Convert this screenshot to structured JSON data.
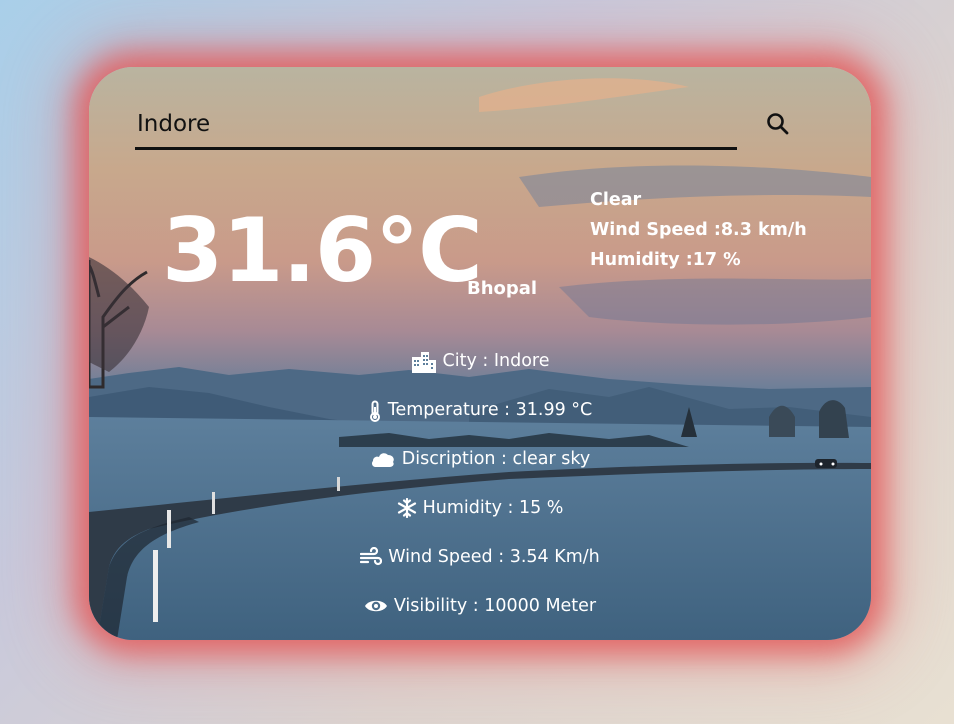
{
  "search": {
    "value": "Indore",
    "icon": "search-icon"
  },
  "current": {
    "temperature": "31.6°C",
    "city": "Bhopal",
    "condition": "Clear",
    "wind": "Wind Speed :8.3 km/h",
    "humidity": "Humidity :17 %"
  },
  "details": [
    {
      "icon": "city-icon",
      "text": "City : Indore"
    },
    {
      "icon": "thermometer-icon",
      "text": "Temperature : 31.99 °C"
    },
    {
      "icon": "cloud-icon",
      "text": "Discription : clear sky"
    },
    {
      "icon": "snowflake-icon",
      "text": "Humidity : 15 %"
    },
    {
      "icon": "wind-icon",
      "text": "Wind Speed : 3.54 Km/h"
    },
    {
      "icon": "eye-icon",
      "text": "Visibility : 10000 Meter"
    }
  ],
  "colors": {
    "glow": "#e25c5c",
    "underline": "#111111",
    "text": "#ffffff"
  }
}
